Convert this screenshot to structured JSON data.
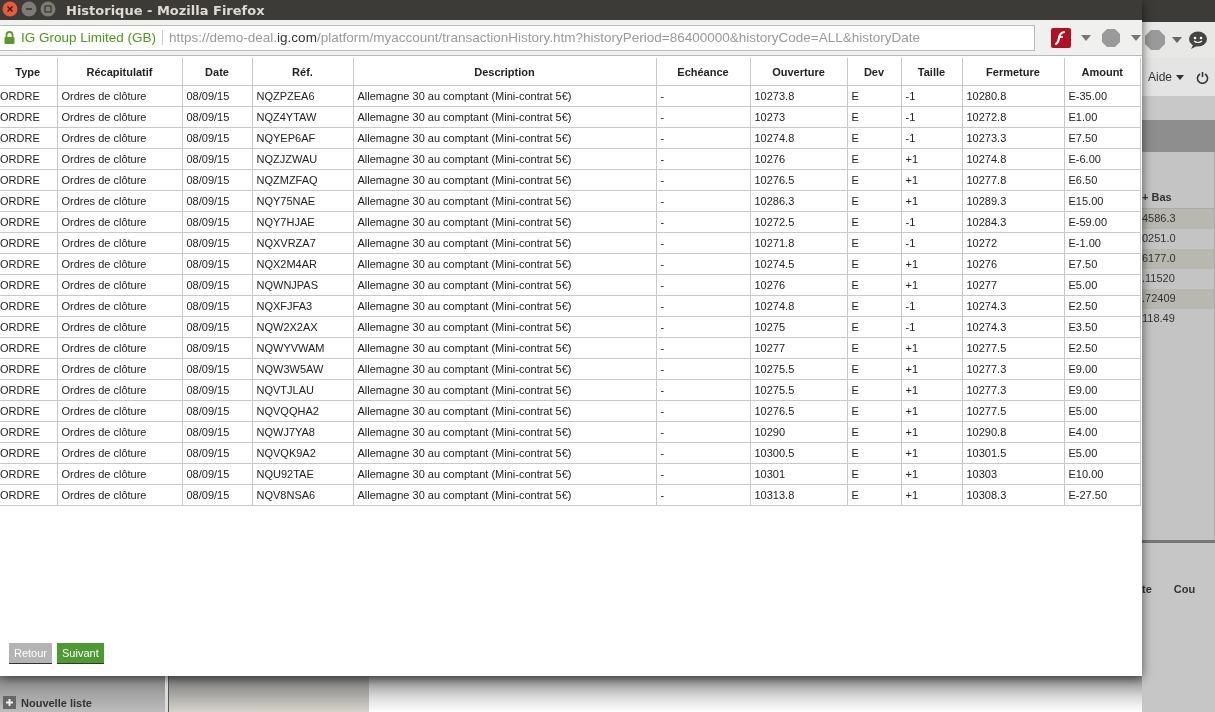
{
  "window": {
    "title": "Historique - Mozilla Firefox"
  },
  "url_bar": {
    "site_identity": "IG Group Limited (GB)",
    "url_prefix": "https://demo-deal.",
    "url_domain": "ig.com",
    "url_rest": "/platform/myaccount/transactionHistory.htm?historyPeriod=86400000&historyCode=ALL&historyDate"
  },
  "table": {
    "columns": [
      "Type",
      "Récapitulatif",
      "Date",
      "Réf.",
      "Description",
      "Echéance",
      "Ouverture",
      "Dev",
      "Taille",
      "Fermeture",
      "Amount"
    ],
    "rows": [
      {
        "cells": [
          "ORDRE",
          "Ordres de clôture",
          "08/09/15",
          "NQZPZEA6",
          "Allemagne 30 au comptant (Mini-contrat 5€)",
          "-",
          "10273.8",
          "E",
          "-1",
          "10280.8",
          "E-35.00"
        ]
      },
      {
        "cells": [
          "ORDRE",
          "Ordres de clôture",
          "08/09/15",
          "NQZ4YTAW",
          "Allemagne 30 au comptant (Mini-contrat 5€)",
          "-",
          "10273",
          "E",
          "-1",
          "10272.8",
          "E1.00"
        ]
      },
      {
        "cells": [
          "ORDRE",
          "Ordres de clôture",
          "08/09/15",
          "NQYEP6AF",
          "Allemagne 30 au comptant (Mini-contrat 5€)",
          "-",
          "10274.8",
          "E",
          "-1",
          "10273.3",
          "E7.50"
        ]
      },
      {
        "cells": [
          "ORDRE",
          "Ordres de clôture",
          "08/09/15",
          "NQZJZWAU",
          "Allemagne 30 au comptant (Mini-contrat 5€)",
          "-",
          "10276",
          "E",
          "+1",
          "10274.8",
          "E-6.00"
        ]
      },
      {
        "cells": [
          "ORDRE",
          "Ordres de clôture",
          "08/09/15",
          "NQZMZFAQ",
          "Allemagne 30 au comptant (Mini-contrat 5€)",
          "-",
          "10276.5",
          "E",
          "+1",
          "10277.8",
          "E6.50"
        ]
      },
      {
        "cells": [
          "ORDRE",
          "Ordres de clôture",
          "08/09/15",
          "NQY75NAE",
          "Allemagne 30 au comptant (Mini-contrat 5€)",
          "-",
          "10286.3",
          "E",
          "+1",
          "10289.3",
          "E15.00"
        ]
      },
      {
        "cells": [
          "ORDRE",
          "Ordres de clôture",
          "08/09/15",
          "NQY7HJAE",
          "Allemagne 30 au comptant (Mini-contrat 5€)",
          "-",
          "10272.5",
          "E",
          "-1",
          "10284.3",
          "E-59.00"
        ]
      },
      {
        "cells": [
          "ORDRE",
          "Ordres de clôture",
          "08/09/15",
          "NQXVRZA7",
          "Allemagne 30 au comptant (Mini-contrat 5€)",
          "-",
          "10271.8",
          "E",
          "-1",
          "10272",
          "E-1.00"
        ]
      },
      {
        "cells": [
          "ORDRE",
          "Ordres de clôture",
          "08/09/15",
          "NQX2M4AR",
          "Allemagne 30 au comptant (Mini-contrat 5€)",
          "-",
          "10274.5",
          "E",
          "+1",
          "10276",
          "E7.50"
        ]
      },
      {
        "cells": [
          "ORDRE",
          "Ordres de clôture",
          "08/09/15",
          "NQWNJPAS",
          "Allemagne 30 au comptant (Mini-contrat 5€)",
          "-",
          "10276",
          "E",
          "+1",
          "10277",
          "E5.00"
        ]
      },
      {
        "cells": [
          "ORDRE",
          "Ordres de clôture",
          "08/09/15",
          "NQXFJFA3",
          "Allemagne 30 au comptant (Mini-contrat 5€)",
          "-",
          "10274.8",
          "E",
          "-1",
          "10274.3",
          "E2.50"
        ]
      },
      {
        "cells": [
          "ORDRE",
          "Ordres de clôture",
          "08/09/15",
          "NQW2X2AX",
          "Allemagne 30 au comptant (Mini-contrat 5€)",
          "-",
          "10275",
          "E",
          "-1",
          "10274.3",
          "E3.50"
        ]
      },
      {
        "cells": [
          "ORDRE",
          "Ordres de clôture",
          "08/09/15",
          "NQWYVWAM",
          "Allemagne 30 au comptant (Mini-contrat 5€)",
          "-",
          "10277",
          "E",
          "+1",
          "10277.5",
          "E2.50"
        ]
      },
      {
        "cells": [
          "ORDRE",
          "Ordres de clôture",
          "08/09/15",
          "NQW3W5AW",
          "Allemagne 30 au comptant (Mini-contrat 5€)",
          "-",
          "10275.5",
          "E",
          "+1",
          "10277.3",
          "E9.00"
        ]
      },
      {
        "cells": [
          "ORDRE",
          "Ordres de clôture",
          "08/09/15",
          "NQVTJLAU",
          "Allemagne 30 au comptant (Mini-contrat 5€)",
          "-",
          "10275.5",
          "E",
          "+1",
          "10277.3",
          "E9.00"
        ]
      },
      {
        "cells": [
          "ORDRE",
          "Ordres de clôture",
          "08/09/15",
          "NQVQQHA2",
          "Allemagne 30 au comptant (Mini-contrat 5€)",
          "-",
          "10276.5",
          "E",
          "+1",
          "10277.5",
          "E5.00"
        ]
      },
      {
        "cells": [
          "ORDRE",
          "Ordres de clôture",
          "08/09/15",
          "NQWJ7YA8",
          "Allemagne 30 au comptant (Mini-contrat 5€)",
          "-",
          "10290",
          "E",
          "+1",
          "10290.8",
          "E4.00"
        ]
      },
      {
        "cells": [
          "ORDRE",
          "Ordres de clôture",
          "08/09/15",
          "NQVQK9A2",
          "Allemagne 30 au comptant (Mini-contrat 5€)",
          "-",
          "10300.5",
          "E",
          "+1",
          "10301.5",
          "E5.00"
        ]
      },
      {
        "cells": [
          "ORDRE",
          "Ordres de clôture",
          "08/09/15",
          "NQU92TAE",
          "Allemagne 30 au comptant (Mini-contrat 5€)",
          "-",
          "10301",
          "E",
          "+1",
          "10303",
          "E10.00"
        ]
      },
      {
        "cells": [
          "ORDRE",
          "Ordres de clôture",
          "08/09/15",
          "NQV8NSA6",
          "Allemagne 30 au comptant (Mini-contrat 5€)",
          "-",
          "10313.8",
          "E",
          "+1",
          "10308.3",
          "E-27.50"
        ]
      }
    ]
  },
  "buttons": [
    {
      "label": "Retour",
      "disabled": true
    },
    {
      "label": "Suivant",
      "disabled": false
    }
  ],
  "background_app": {
    "menu": "Aide",
    "panel_header": "+ Bas",
    "panel_values": [
      "4586.3",
      "0251.0",
      "6177.0",
      ".11520",
      ".72409",
      "118.49"
    ],
    "bottom_headers": [
      "te",
      "Cou"
    ],
    "watchlist_button": "Nouvelle liste"
  }
}
